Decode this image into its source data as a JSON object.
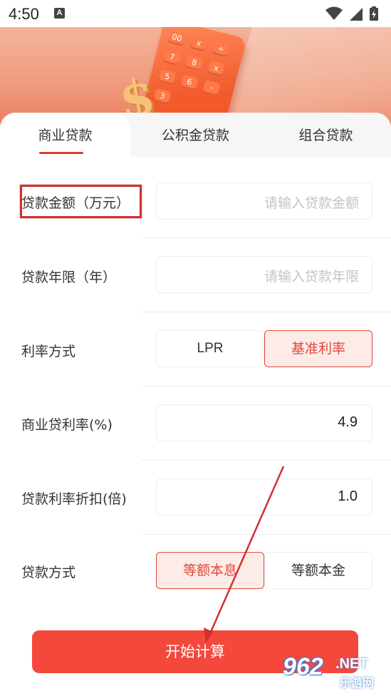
{
  "status_bar": {
    "time": "4:50",
    "notification_icon": "a-icon",
    "icons": [
      "wifi-icon",
      "signal-icon",
      "battery-charging-icon"
    ]
  },
  "banner": {
    "calculator_keys": [
      "00",
      "x",
      "÷",
      "7",
      "8",
      "x",
      "5",
      "6",
      "-",
      "3"
    ],
    "dollar_sign": "$"
  },
  "tabs": [
    {
      "label": "商业贷款",
      "active": true
    },
    {
      "label": "公积金贷款",
      "active": false
    },
    {
      "label": "组合贷款",
      "active": false
    }
  ],
  "form": {
    "amount": {
      "label": "贷款金额（万元）",
      "placeholder": "请输入贷款金额",
      "highlighted": true
    },
    "years": {
      "label": "贷款年限（年）",
      "placeholder": "请输入贷款年限"
    },
    "rate_mode": {
      "label": "利率方式",
      "options": [
        "LPR",
        "基准利率"
      ],
      "selected": "基准利率"
    },
    "commercial_rate": {
      "label": "商业贷利率(%)",
      "value": "4.9"
    },
    "discount": {
      "label": "贷款利率折扣(倍)",
      "value": "1.0"
    },
    "repay_mode": {
      "label": "贷款方式",
      "options": [
        "等额本息",
        "等额本金"
      ],
      "selected": "等额本息"
    }
  },
  "calculate_button": "开始计算",
  "watermark": {
    "number": "962",
    "suffix": ".NET",
    "cn": "乐游网"
  },
  "colors": {
    "accent": "#f5483c",
    "highlight_border": "#d32f2f",
    "selected_bg": "#fdebe7"
  }
}
